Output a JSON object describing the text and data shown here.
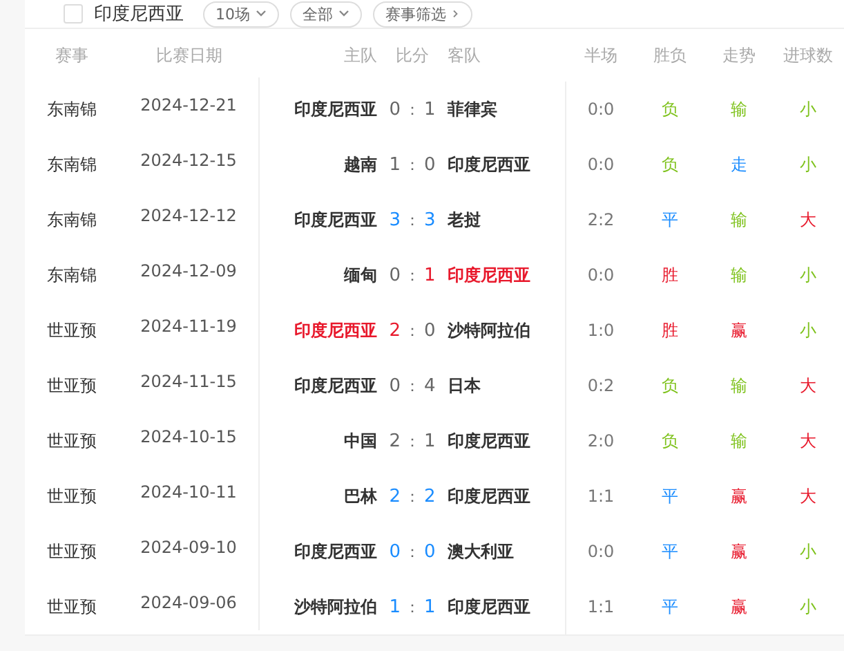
{
  "filter_bar": {
    "team": "印度尼西亚",
    "checked": false,
    "dropdowns": [
      {
        "label": "10场",
        "kind": "dropdown"
      },
      {
        "label": "全部",
        "kind": "dropdown"
      },
      {
        "label": "赛事筛选",
        "kind": "link"
      }
    ]
  },
  "table": {
    "columns": [
      "赛事",
      "比赛日期",
      "主队",
      "比分",
      "客队",
      "半场",
      "胜负",
      "走势",
      "进球数"
    ],
    "rows": [
      {
        "event": "东南锦",
        "date": "2024-12-21",
        "home": {
          "name": "印度尼西亚",
          "color": "#333333"
        },
        "score": {
          "home": {
            "text": "0",
            "color": "#666666"
          },
          "sep": "：",
          "away": {
            "text": "1",
            "color": "#666666"
          }
        },
        "away": {
          "name": "菲律宾",
          "color": "#333333"
        },
        "half": "0:0",
        "result": {
          "text": "负",
          "color": "#7ec21c"
        },
        "trend": {
          "text": "输",
          "color": "#7ec21c"
        },
        "goals": {
          "text": "小",
          "color": "#7ec21c"
        }
      },
      {
        "event": "东南锦",
        "date": "2024-12-15",
        "home": {
          "name": "越南",
          "color": "#333333"
        },
        "score": {
          "home": {
            "text": "1",
            "color": "#666666"
          },
          "sep": "：",
          "away": {
            "text": "0",
            "color": "#666666"
          }
        },
        "away": {
          "name": "印度尼西亚",
          "color": "#333333"
        },
        "half": "0:0",
        "result": {
          "text": "负",
          "color": "#7ec21c"
        },
        "trend": {
          "text": "走",
          "color": "#1a8cff"
        },
        "goals": {
          "text": "小",
          "color": "#7ec21c"
        }
      },
      {
        "event": "东南锦",
        "date": "2024-12-12",
        "home": {
          "name": "印度尼西亚",
          "color": "#333333"
        },
        "score": {
          "home": {
            "text": "3",
            "color": "#1a8cff"
          },
          "sep": "：",
          "away": {
            "text": "3",
            "color": "#1a8cff"
          }
        },
        "away": {
          "name": "老挝",
          "color": "#333333"
        },
        "half": "2:2",
        "result": {
          "text": "平",
          "color": "#1a8cff"
        },
        "trend": {
          "text": "输",
          "color": "#7ec21c"
        },
        "goals": {
          "text": "大",
          "color": "#e8192c"
        }
      },
      {
        "event": "东南锦",
        "date": "2024-12-09",
        "home": {
          "name": "缅甸",
          "color": "#333333"
        },
        "score": {
          "home": {
            "text": "0",
            "color": "#666666"
          },
          "sep": "：",
          "away": {
            "text": "1",
            "color": "#e8192c"
          }
        },
        "away": {
          "name": "印度尼西亚",
          "color": "#e8192c"
        },
        "half": "0:0",
        "result": {
          "text": "胜",
          "color": "#e8192c"
        },
        "trend": {
          "text": "输",
          "color": "#7ec21c"
        },
        "goals": {
          "text": "小",
          "color": "#7ec21c"
        }
      },
      {
        "event": "世亚预",
        "date": "2024-11-19",
        "home": {
          "name": "印度尼西亚",
          "color": "#e8192c"
        },
        "score": {
          "home": {
            "text": "2",
            "color": "#e8192c"
          },
          "sep": "：",
          "away": {
            "text": "0",
            "color": "#666666"
          }
        },
        "away": {
          "name": "沙特阿拉伯",
          "color": "#333333"
        },
        "half": "1:0",
        "result": {
          "text": "胜",
          "color": "#e8192c"
        },
        "trend": {
          "text": "赢",
          "color": "#e8192c"
        },
        "goals": {
          "text": "小",
          "color": "#7ec21c"
        }
      },
      {
        "event": "世亚预",
        "date": "2024-11-15",
        "home": {
          "name": "印度尼西亚",
          "color": "#333333"
        },
        "score": {
          "home": {
            "text": "0",
            "color": "#666666"
          },
          "sep": "：",
          "away": {
            "text": "4",
            "color": "#666666"
          }
        },
        "away": {
          "name": "日本",
          "color": "#333333"
        },
        "half": "0:2",
        "result": {
          "text": "负",
          "color": "#7ec21c"
        },
        "trend": {
          "text": "输",
          "color": "#7ec21c"
        },
        "goals": {
          "text": "大",
          "color": "#e8192c"
        }
      },
      {
        "event": "世亚预",
        "date": "2024-10-15",
        "home": {
          "name": "中国",
          "color": "#333333"
        },
        "score": {
          "home": {
            "text": "2",
            "color": "#666666"
          },
          "sep": "：",
          "away": {
            "text": "1",
            "color": "#666666"
          }
        },
        "away": {
          "name": "印度尼西亚",
          "color": "#333333"
        },
        "half": "2:0",
        "result": {
          "text": "负",
          "color": "#7ec21c"
        },
        "trend": {
          "text": "输",
          "color": "#7ec21c"
        },
        "goals": {
          "text": "大",
          "color": "#e8192c"
        }
      },
      {
        "event": "世亚预",
        "date": "2024-10-11",
        "home": {
          "name": "巴林",
          "color": "#333333"
        },
        "score": {
          "home": {
            "text": "2",
            "color": "#1a8cff"
          },
          "sep": "：",
          "away": {
            "text": "2",
            "color": "#1a8cff"
          }
        },
        "away": {
          "name": "印度尼西亚",
          "color": "#333333"
        },
        "half": "1:1",
        "result": {
          "text": "平",
          "color": "#1a8cff"
        },
        "trend": {
          "text": "赢",
          "color": "#e8192c"
        },
        "goals": {
          "text": "大",
          "color": "#e8192c"
        }
      },
      {
        "event": "世亚预",
        "date": "2024-09-10",
        "home": {
          "name": "印度尼西亚",
          "color": "#333333"
        },
        "score": {
          "home": {
            "text": "0",
            "color": "#1a8cff"
          },
          "sep": "：",
          "away": {
            "text": "0",
            "color": "#1a8cff"
          }
        },
        "away": {
          "name": "澳大利亚",
          "color": "#333333"
        },
        "half": "0:0",
        "result": {
          "text": "平",
          "color": "#1a8cff"
        },
        "trend": {
          "text": "赢",
          "color": "#e8192c"
        },
        "goals": {
          "text": "小",
          "color": "#7ec21c"
        }
      },
      {
        "event": "世亚预",
        "date": "2024-09-06",
        "home": {
          "name": "沙特阿拉伯",
          "color": "#333333"
        },
        "score": {
          "home": {
            "text": "1",
            "color": "#1a8cff"
          },
          "sep": "：",
          "away": {
            "text": "1",
            "color": "#1a8cff"
          }
        },
        "away": {
          "name": "印度尼西亚",
          "color": "#333333"
        },
        "half": "1:1",
        "result": {
          "text": "平",
          "color": "#1a8cff"
        },
        "trend": {
          "text": "赢",
          "color": "#e8192c"
        },
        "goals": {
          "text": "小",
          "color": "#7ec21c"
        }
      }
    ]
  }
}
